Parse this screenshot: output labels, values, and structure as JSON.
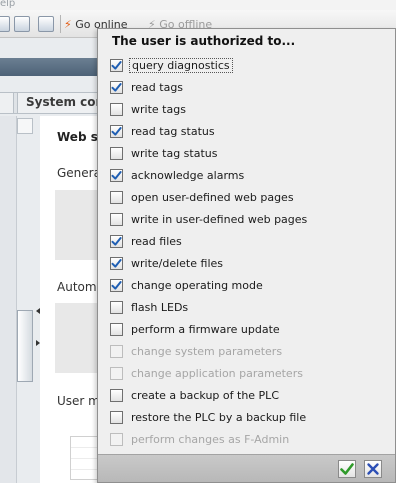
{
  "menubar": {
    "fragment": "elp"
  },
  "toolbar": {
    "go_online_label": "Go online",
    "go_offline_label": "Go offline"
  },
  "background": {
    "tab_label": "System con",
    "section_title": "Web s",
    "general_label": "Genera",
    "automatic_label": "Autom",
    "user_label": "User m"
  },
  "popup": {
    "title": "The user is authorized to...",
    "permissions": [
      {
        "label": "query diagnostics",
        "checked": true,
        "enabled": true,
        "focused": true
      },
      {
        "label": "read tags",
        "checked": true,
        "enabled": true
      },
      {
        "label": "write tags",
        "checked": false,
        "enabled": true
      },
      {
        "label": "read tag status",
        "checked": true,
        "enabled": true
      },
      {
        "label": "write tag status",
        "checked": false,
        "enabled": true
      },
      {
        "label": "acknowledge alarms",
        "checked": true,
        "enabled": true
      },
      {
        "label": "open user-defined web pages",
        "checked": false,
        "enabled": true
      },
      {
        "label": "write in user-defined web pages",
        "checked": false,
        "enabled": true
      },
      {
        "label": "read files",
        "checked": true,
        "enabled": true
      },
      {
        "label": "write/delete files",
        "checked": true,
        "enabled": true
      },
      {
        "label": "change operating mode",
        "checked": true,
        "enabled": true
      },
      {
        "label": "flash LEDs",
        "checked": false,
        "enabled": true
      },
      {
        "label": "perform a firmware update",
        "checked": false,
        "enabled": true
      },
      {
        "label": "change system parameters",
        "checked": false,
        "enabled": false
      },
      {
        "label": "change application parameters",
        "checked": false,
        "enabled": false
      },
      {
        "label": "create a backup of the PLC",
        "checked": false,
        "enabled": true
      },
      {
        "label": "restore the PLC by a backup file",
        "checked": false,
        "enabled": true
      },
      {
        "label": "perform changes as F-Admin",
        "checked": false,
        "enabled": false
      }
    ],
    "confirm_icon": "green-checkmark-icon",
    "cancel_icon": "blue-x-icon"
  },
  "colors": {
    "check_blue": "#1f5fb4",
    "confirm_green": "#2f9a2a",
    "cancel_blue": "#2c4fb5",
    "disabled_text": "#a6a6a6"
  }
}
